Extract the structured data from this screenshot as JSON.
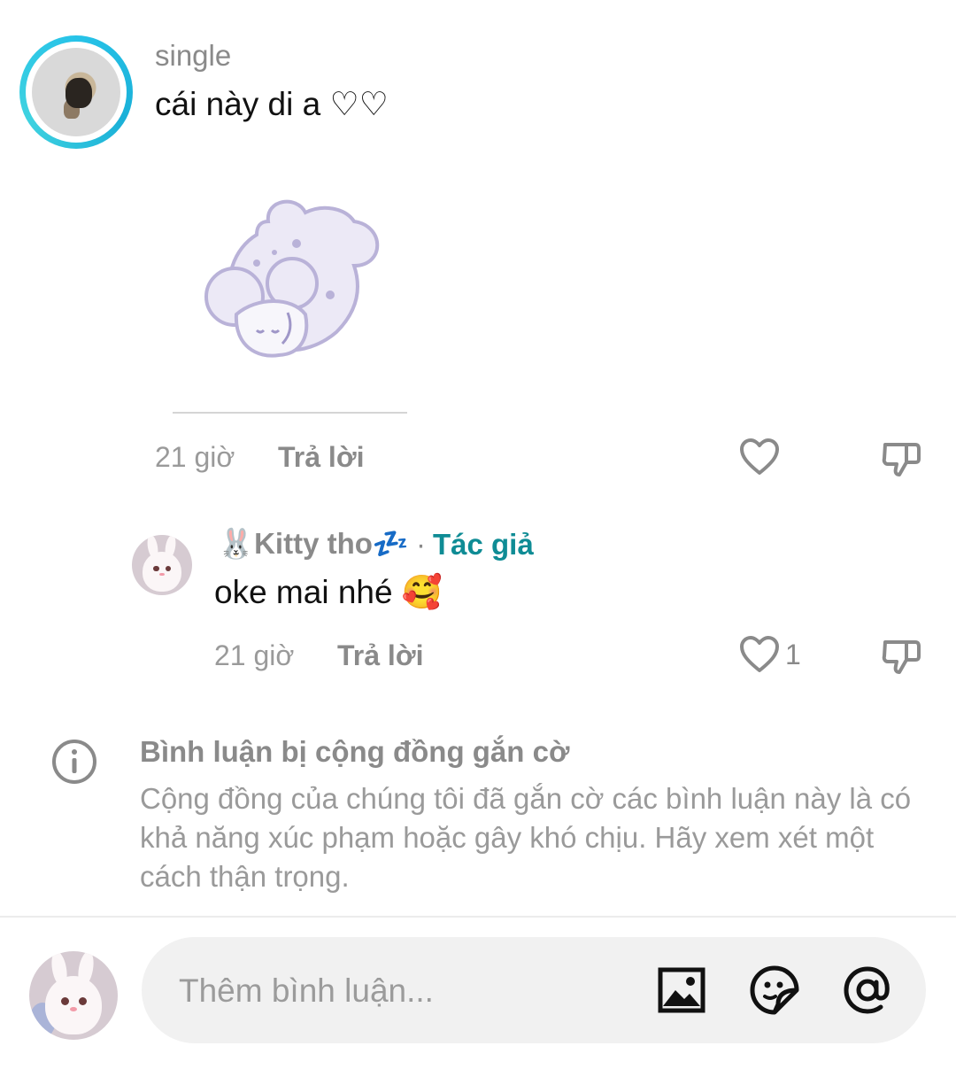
{
  "comment": {
    "username": "single",
    "text": "cái này di a ♡♡",
    "time": "21 giờ",
    "reply_label": "Trả lời"
  },
  "reply": {
    "username": "🐰Kitty tho💤",
    "separator": "·",
    "author_badge": "Tác giả",
    "text": "oke mai nhé 🥰",
    "time": "21 giờ",
    "reply_label": "Trả lời",
    "like_count": "1"
  },
  "flag_notice": {
    "title": "Bình luận bị cộng đồng gắn cờ",
    "body": "Cộng đồng của chúng tôi đã gắn cờ các bình luận này là có khả năng xúc phạm hoặc gây khó chịu. Hãy xem xét một cách thận trọng."
  },
  "composer": {
    "placeholder": "Thêm bình luận..."
  },
  "colors": {
    "author_badge": "#0f8c95",
    "story_ring": "#27c3e8",
    "sticker": "#b9b2d8"
  }
}
